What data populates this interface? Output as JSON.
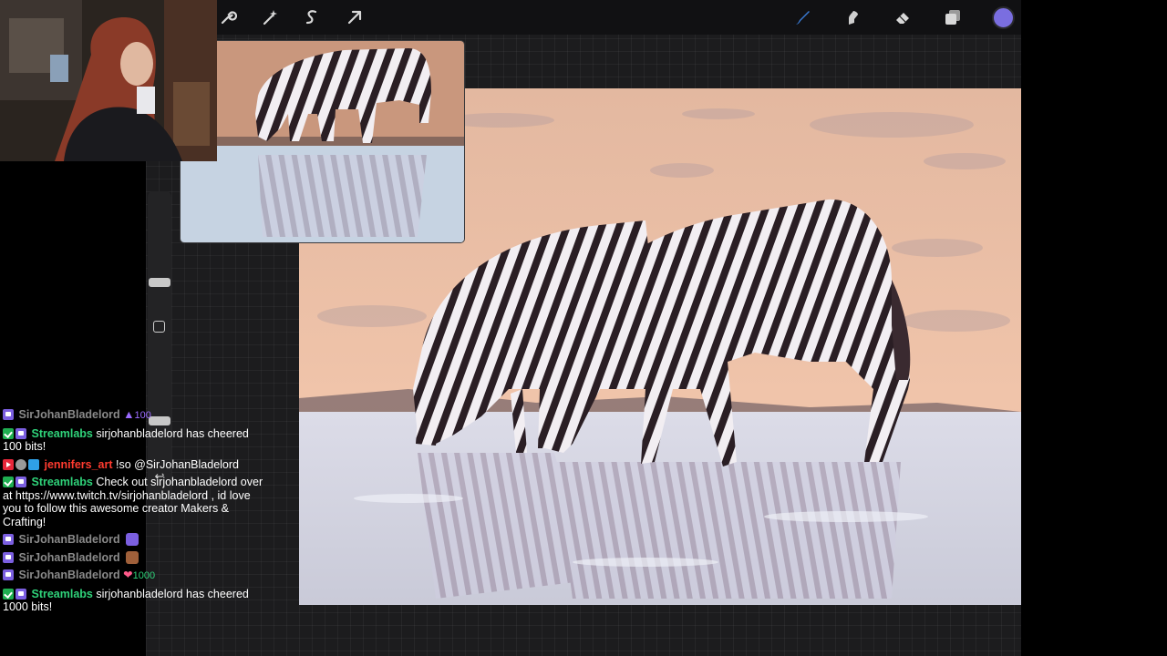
{
  "toolbar": {
    "left_tools": [
      "wrench-icon",
      "magic-wand-icon",
      "selection-icon",
      "transform-arrow-icon"
    ],
    "right_tools": [
      "brush-icon",
      "smudge-icon",
      "eraser-icon",
      "layers-icon"
    ],
    "current_color": "#7a6ee0",
    "brush_color": "#3a7bd5"
  },
  "sidebar": {
    "undo_glyph": "↩"
  },
  "chat": {
    "messages": [
      {
        "user": "SirJohanBladelord",
        "text": "",
        "cheer": "100"
      },
      {
        "user": "Streamlabs",
        "text": "sirjohanbladelord has cheered 100 bits!"
      },
      {
        "user": "jennifers_art",
        "text": "!so @SirJohanBladelord"
      },
      {
        "user": "Streamlabs",
        "text": "Check out sirjohanbladelord over at https://www.twitch.tv/sirjohanbladelord , id love you to follow this awesome creator Makers & Crafting!"
      },
      {
        "user": "SirJohanBladelord",
        "text": ""
      },
      {
        "user": "SirJohanBladelord",
        "text": ""
      },
      {
        "user": "SirJohanBladelord",
        "text": "",
        "cheer": "1000"
      },
      {
        "user": "Streamlabs",
        "text": "sirjohanbladelord has cheered 1000 bits!"
      }
    ]
  },
  "colors": {
    "app_bg": "#1c1c1e",
    "accent_green": "#2fd37a",
    "accent_red": "#ff3b2f",
    "cheer_purple": "#9b6bff",
    "cheer_green": "#2fd37a"
  }
}
